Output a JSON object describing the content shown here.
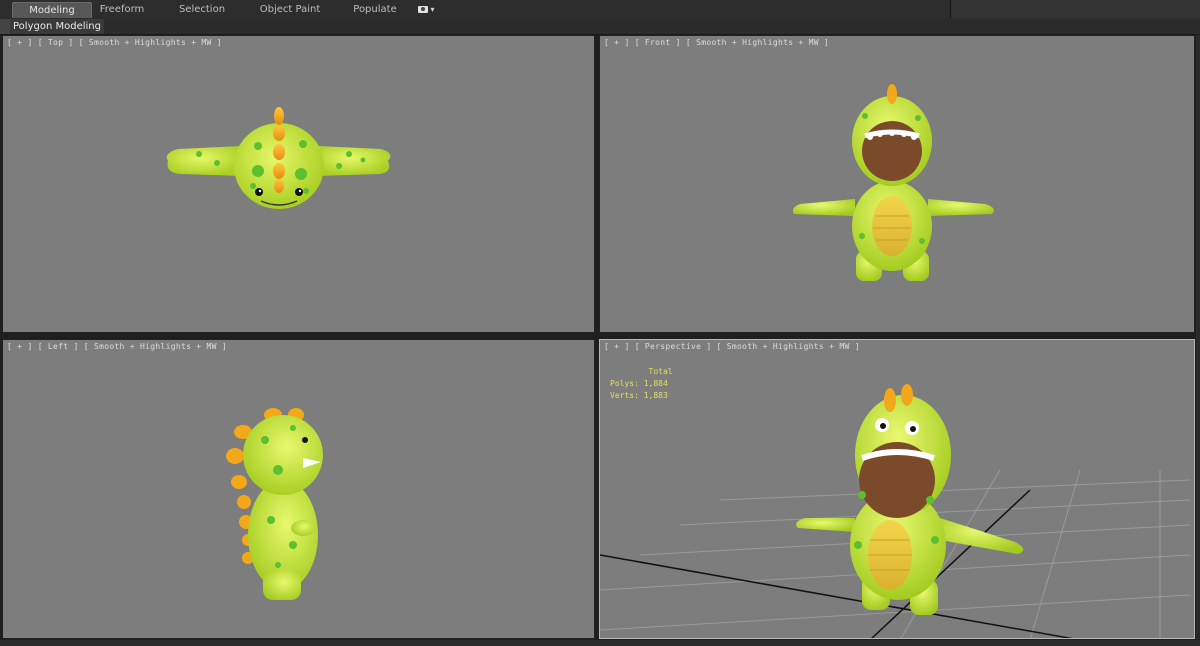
{
  "ribbon": {
    "tabs": [
      {
        "label": "Modeling",
        "active": true
      },
      {
        "label": "Freeform",
        "active": false
      },
      {
        "label": "Selection",
        "active": false
      },
      {
        "label": "Object Paint",
        "active": false
      },
      {
        "label": "Populate",
        "active": false
      }
    ],
    "options_icon": "camera-dropdown-icon"
  },
  "panel": {
    "label": "Polygon Modeling"
  },
  "viewports": {
    "top": {
      "label": "[ + ] [ Top ] [ Smooth + Highlights + MW ]"
    },
    "front": {
      "label": "[ + ] [ Front ] [ Smooth + Highlights + MW ]"
    },
    "left": {
      "label": "[ + ] [ Left ] [ Smooth + Highlights + MW ]"
    },
    "perspective": {
      "label": "[ + ] [ Perspective ] [ Smooth + Highlights + MW ]"
    }
  },
  "stats": {
    "header": "Total",
    "polys_label": "Polys:",
    "polys_value": "1,884",
    "verts_label": "Verts:",
    "verts_value": "1,883"
  },
  "colors": {
    "viewport_bg": "#7d7d7d",
    "character_body": "#c8e635",
    "character_spots": "#5cc02e",
    "spikes": "#f0a818",
    "belly": "#e6c53a",
    "mouth": "#7a4a2a",
    "stats_text": "#e2e060"
  }
}
